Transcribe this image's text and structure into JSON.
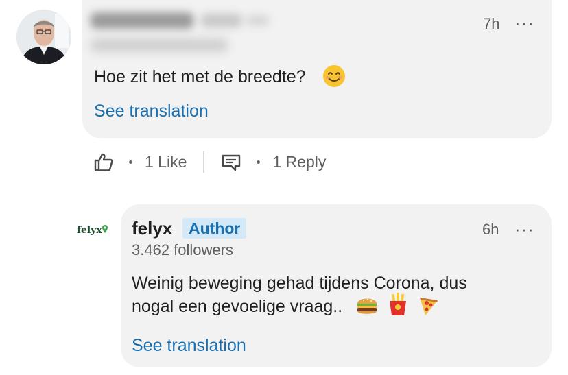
{
  "comment1": {
    "time": "7h",
    "more": "···",
    "text": "Hoe zit het met de breedte?",
    "emoji": "smiling-face-emoji",
    "translate_label": "See translation"
  },
  "actions": {
    "like_count": "1 Like",
    "reply_count": "1 Reply"
  },
  "reply": {
    "author": "felyx",
    "logo_text": "felyx",
    "badge": "Author",
    "followers": "3.462 followers",
    "time": "6h",
    "more": "···",
    "text_line1": "Weinig beweging gehad tijdens Corona, dus",
    "text_line2": "nogal een gevoelige vraag..",
    "emojis": [
      "hamburger-emoji",
      "fries-emoji",
      "pizza-emoji"
    ],
    "translate_label": "See translation"
  },
  "colors": {
    "bubble": "#f2f2f2",
    "link": "#1a6fb0",
    "badge_bg": "#d3e9f7",
    "brand_green": "#1b4d2a"
  }
}
